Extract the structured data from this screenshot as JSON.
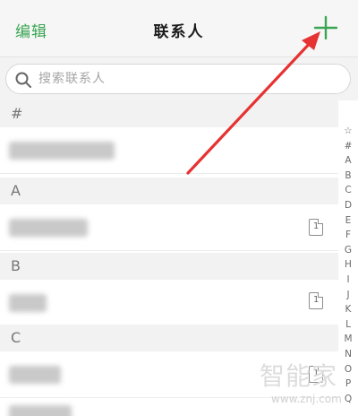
{
  "navbar": {
    "edit_label": "编辑",
    "title": "联系人",
    "add_icon": "plus-icon"
  },
  "search": {
    "placeholder": "搜索联系人",
    "value": "",
    "icon": "search-icon"
  },
  "sections": [
    {
      "header": "#"
    },
    {
      "header": "A"
    },
    {
      "header": "B"
    },
    {
      "header": "C"
    }
  ],
  "contacts": [
    {
      "section": "#",
      "name": "",
      "sim": false
    },
    {
      "section": "A",
      "name": "",
      "sim": true,
      "sim_label": "1"
    },
    {
      "section": "B",
      "name": "",
      "sim": true,
      "sim_label": "1"
    },
    {
      "section": "C",
      "name": "",
      "sim": true,
      "sim_label": "1"
    }
  ],
  "index_letters": [
    "☆",
    "#",
    "A",
    "B",
    "C",
    "D",
    "E",
    "F",
    "G",
    "H",
    "I",
    "J",
    "K",
    "L",
    "M",
    "N",
    "O",
    "P",
    "Q"
  ],
  "annotation": {
    "arrow_color": "#e63232"
  },
  "watermark": {
    "logo": "智能家",
    "url": "www.znj.com"
  },
  "colors": {
    "accent_green": "#3aa552",
    "background": "#ffffff"
  }
}
